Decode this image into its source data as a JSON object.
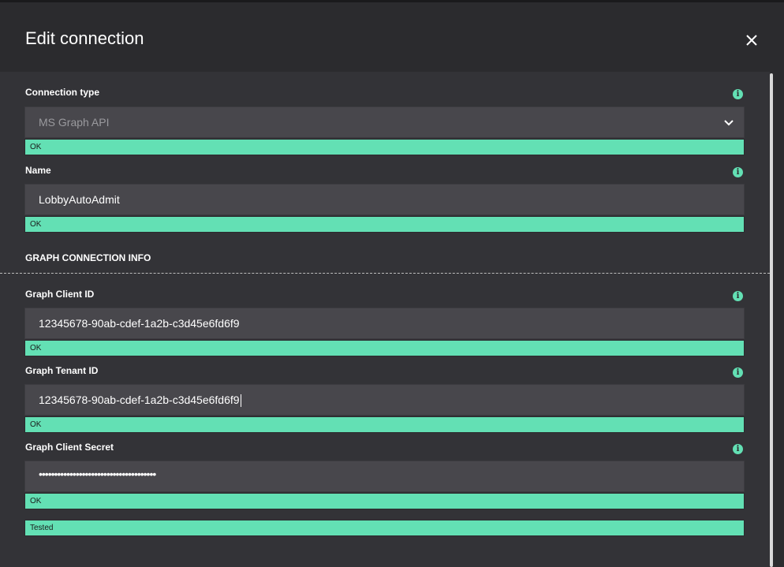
{
  "dialog": {
    "title": "Edit connection",
    "close_icon": "close-icon"
  },
  "fields": {
    "connection_type": {
      "label": "Connection type",
      "value": "MS Graph API",
      "status": "OK"
    },
    "name": {
      "label": "Name",
      "value": "LobbyAutoAdmit",
      "status": "OK"
    },
    "graph_client_id": {
      "label": "Graph Client ID",
      "value": "12345678-90ab-cdef-1a2b-c3d45e6fd6f9",
      "status": "OK"
    },
    "graph_tenant_id": {
      "label": "Graph Tenant ID",
      "value": "12345678-90ab-cdef-1a2b-c3d45e6fd6f9",
      "status": "OK"
    },
    "graph_client_secret": {
      "label": "Graph Client Secret",
      "value": "••••••••••••••••••••••••••••••••••••••",
      "status": "OK"
    }
  },
  "section": {
    "title": "GRAPH CONNECTION INFO"
  },
  "test_status": "Tested",
  "info_icon_glyph": "i",
  "colors": {
    "accent": "#63e0b4",
    "background": "#2b2b2e",
    "panel": "#333337",
    "input": "#48474c"
  }
}
